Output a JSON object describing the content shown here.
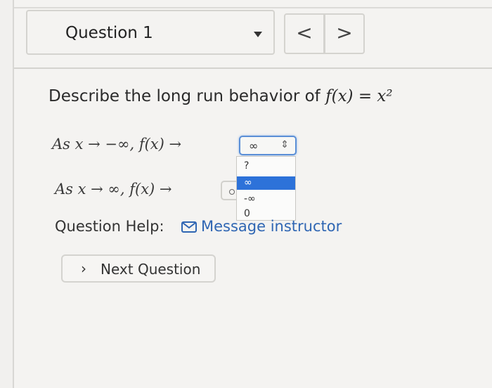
{
  "header": {
    "question_select_label": "Question 1",
    "prev_label": "<",
    "next_label": ">"
  },
  "question": {
    "prompt_text": "Describe the long run behavior of ",
    "function_expr": "f(x) = x²",
    "line1_text": "As x → −∞, f(x) →",
    "line2_text": "As x → ∞, f(x) →",
    "dropdown1_value": "∞",
    "dropdown1_options": [
      "?",
      "∞",
      "-∞",
      "0"
    ],
    "dropdown1_highlighted": "∞"
  },
  "help": {
    "label": "Question Help:",
    "message_label": "Message instructor"
  },
  "footer": {
    "next_question_label": "Next Question"
  },
  "colors": {
    "link": "#2f66b3",
    "highlight": "#2d72d9",
    "focus_border": "#5b8fd6"
  }
}
